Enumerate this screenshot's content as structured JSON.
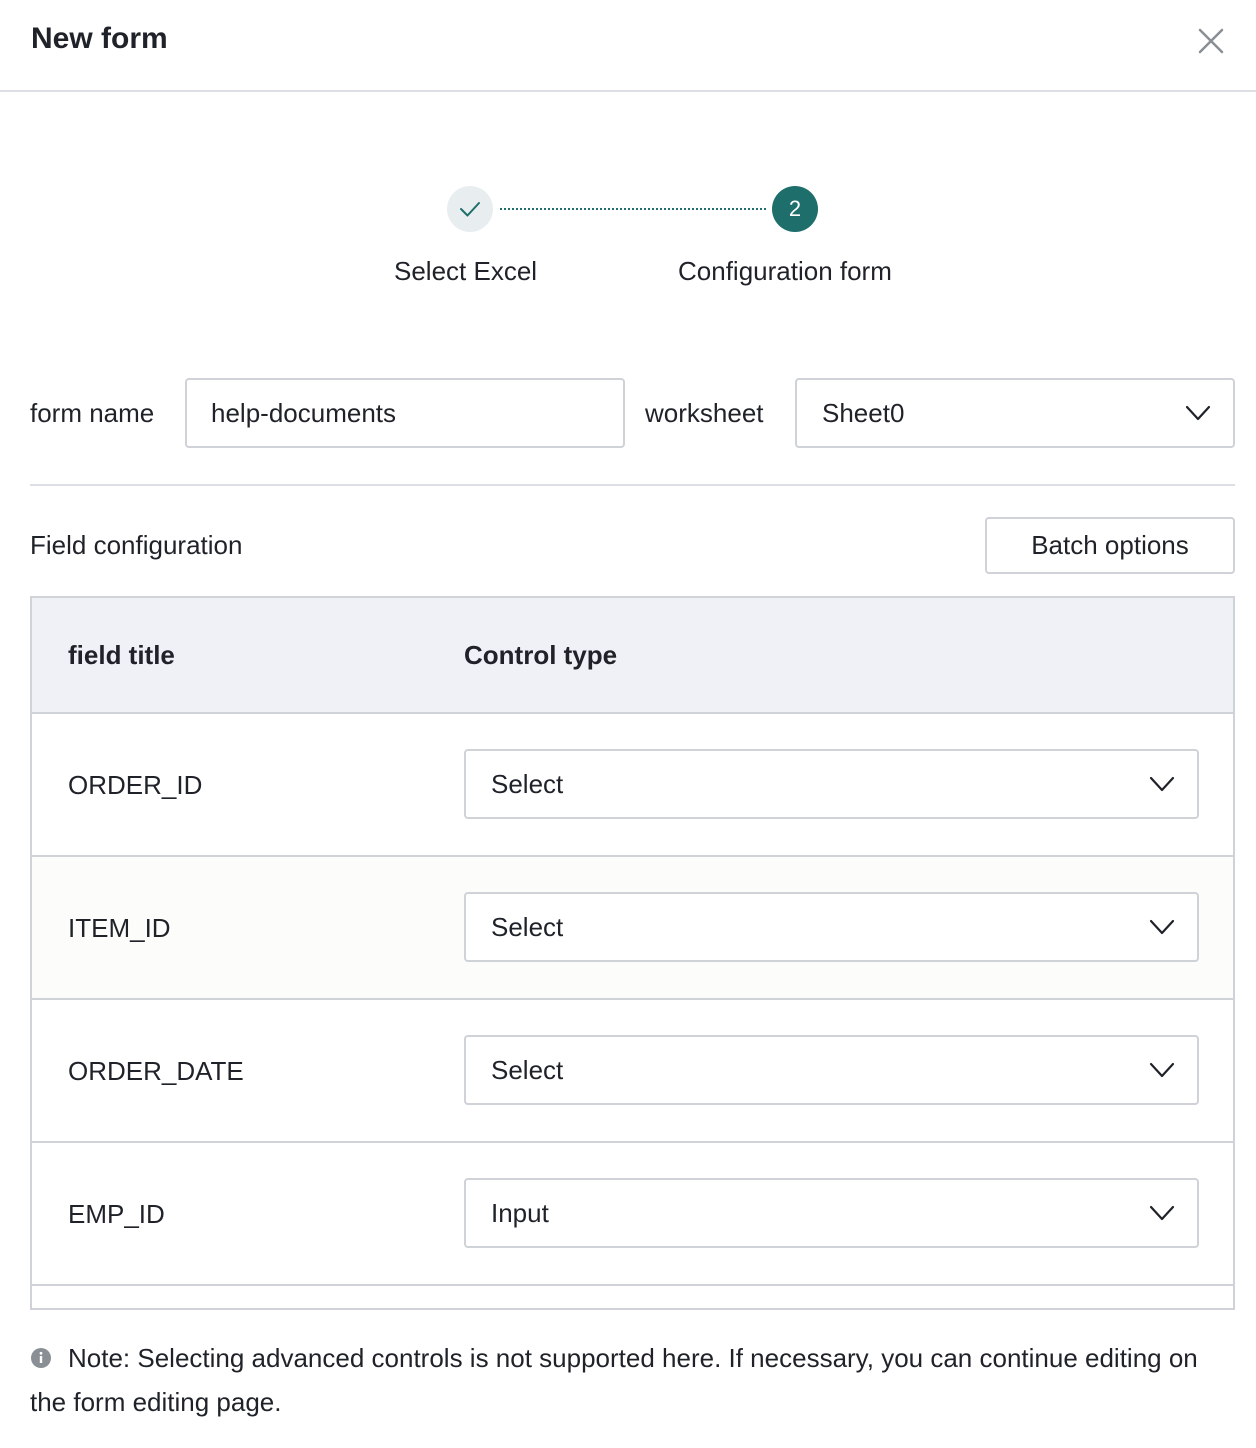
{
  "dialog": {
    "title": "New form",
    "close_icon": "close-icon"
  },
  "steps": [
    {
      "label": "Select Excel",
      "status": "completed",
      "icon": "check-icon"
    },
    {
      "label": "Configuration form",
      "number": "2",
      "status": "active"
    }
  ],
  "form": {
    "name_label": "form name",
    "name_value": "help-documents",
    "worksheet_label": "worksheet",
    "worksheet_value": "Sheet0"
  },
  "field_config": {
    "title": "Field configuration",
    "batch_button": "Batch options",
    "columns": [
      "field title",
      "Control type"
    ],
    "rows": [
      {
        "field": "ORDER_ID",
        "control": "Select"
      },
      {
        "field": "ITEM_ID",
        "control": "Select"
      },
      {
        "field": "ORDER_DATE",
        "control": "Select"
      },
      {
        "field": "EMP_ID",
        "control": "Input"
      }
    ]
  },
  "note": "Note: Selecting advanced controls is not supported here. If necessary, you can continue editing on the form editing page.",
  "colors": {
    "accent": "#1e6f6b",
    "border": "#cfd3d8",
    "header_bg": "#eff1f6"
  }
}
